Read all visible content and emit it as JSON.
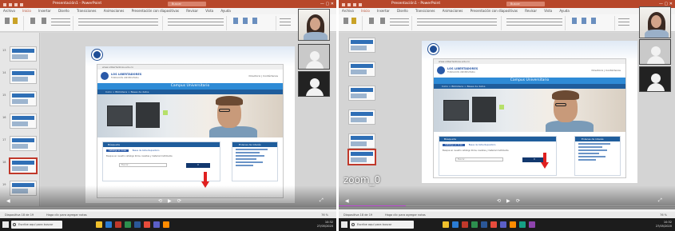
{
  "left": {
    "title": "Presentación1 - PowerPoint",
    "search_placeholder": "Buscar",
    "tabs": [
      "Archivo",
      "Inicio",
      "Insertar",
      "Diseño",
      "Transiciones",
      "Animaciones",
      "Presentación con diapositivas",
      "Revisar",
      "Vista",
      "Ayuda"
    ],
    "active_tab": "Inicio",
    "slide_numbers": [
      "13",
      "14",
      "15",
      "16",
      "17",
      "18",
      "19"
    ],
    "selected_slide": "18",
    "notes_label": "Haga clic para agregar notas",
    "status_text": "Diapositiva 18 de 19",
    "zoom_text": "76 %"
  },
  "right": {
    "title": "Presentación1 - PowerPoint",
    "search_placeholder": "Buscar",
    "tabs": [
      "Archivo",
      "Inicio",
      "Insertar",
      "Diseño",
      "Transiciones",
      "Animaciones",
      "Presentación con diapositivas",
      "Revisar",
      "Vista",
      "Ayuda"
    ],
    "active_tab": "Inicio",
    "zoom_overlay": "zoom_0",
    "notes_label": "Haga clic para agregar notas",
    "status_text": "Diapositiva 18 de 19",
    "zoom_text": "76 %"
  },
  "slide_content": {
    "browser_address": "www.ulibertadores.edu.co",
    "university_name": "LOS LIBERTADORES",
    "university_subtitle": "FUNDACIÓN UNIVERSITARIA",
    "utility_links": "Directorio  |  Contáctenos",
    "banner_text": "Campus Universitario",
    "nav_text": "Inicio  >  Biblioteca  >  Bases de datos",
    "panel_tabs": [
      "Catálogo en línea",
      "Bases de datos",
      "Repositorio"
    ],
    "panel_title": "Búsqueda",
    "panel_prompt": "Busque en nuestro catálogo libros, revistas y material multimedia",
    "search_field": "Buscar...",
    "search_button": "Ir",
    "side_title": "Enlaces de interés"
  },
  "progress": {
    "fill": 0.2
  },
  "taskbar": {
    "search_placeholder": "Escribe aquí para buscar",
    "time": "10:32",
    "date": "27/05/2020"
  },
  "colors": {
    "powerpoint_accent": "#b7472a",
    "site_blue": "#2e8bd6",
    "arrow_red": "#e02020"
  },
  "icons": [
    "search-icon",
    "windows-start-icon",
    "close-icon",
    "minimize-icon",
    "maximize-icon"
  ]
}
